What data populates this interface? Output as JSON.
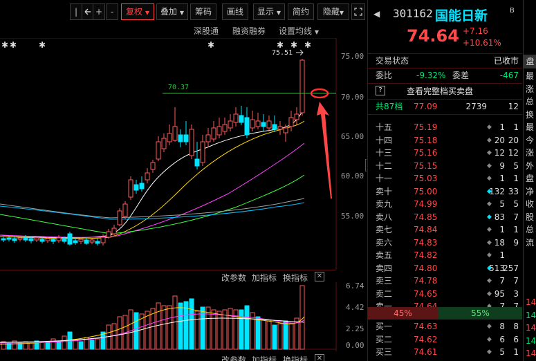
{
  "toolbar": {
    "buttons": [
      "|",
      "+",
      "-",
      "复权",
      "叠加",
      "筹码",
      "画线",
      "显示",
      "简约",
      "隐藏"
    ],
    "icons": [
      "back-arrow-icon",
      "fullscreen-icon"
    ]
  },
  "subbar": {
    "shenzhen": "深股通",
    "margin": "融资融券",
    "set_ma": "设置均线"
  },
  "price_chart": {
    "high_label": "75.51",
    "level_label": "70.37",
    "y_ticks": [
      "75.00",
      "70.00",
      "65.00",
      "60.00",
      "55.00"
    ]
  },
  "indicator_bar1": {
    "change_param": "改参数",
    "add_indicator": "加指标",
    "swap_indicator": "换指标"
  },
  "volume_chart": {
    "y_ticks": [
      "6.74",
      "4.42",
      "2.25",
      "0.00"
    ]
  },
  "indicator_bar2": {
    "change_param": "改参数",
    "add_indicator": "加指标",
    "swap_indicator": "换指标"
  },
  "quote": {
    "code": "301162",
    "name": "国能日新",
    "price": "74.64",
    "change": "+7.16",
    "change_pct": "+10.61%",
    "status_label": "交易状态",
    "status_value": "已收市",
    "wb_label": "委比",
    "wb_value": "-9.32%",
    "wc_label": "委差",
    "wc_value": "-467",
    "help_icon": "?",
    "full_book": "查看完整档买卖盘",
    "total_label": "共87档",
    "total_price": "77.09",
    "total_vol": "2739",
    "total_chg": "12",
    "ratio_sell": "45%",
    "ratio_buy": "55%",
    "colors": {
      "up": "#ff4a4a",
      "down": "#00e676",
      "accent": "#00e5ff"
    }
  },
  "asks": [
    {
      "label": "十五",
      "price": "75.19",
      "vol": "1",
      "chg": "1"
    },
    {
      "label": "十四",
      "price": "75.18",
      "vol": "20",
      "chg": "20"
    },
    {
      "label": "十三",
      "price": "75.16",
      "vol": "12",
      "chg": "12"
    },
    {
      "label": "十二",
      "price": "75.15",
      "vol": "9",
      "chg": "5"
    },
    {
      "label": "十一",
      "price": "75.03",
      "vol": "1",
      "chg": "1"
    },
    {
      "label": "卖十",
      "price": "75.00",
      "vol": "132",
      "chg": "33"
    },
    {
      "label": "卖九",
      "price": "74.99",
      "vol": "5",
      "chg": "5"
    },
    {
      "label": "卖八",
      "price": "74.85",
      "vol": "83",
      "chg": "7"
    },
    {
      "label": "卖七",
      "price": "74.84",
      "vol": "1",
      "chg": "1"
    },
    {
      "label": "卖六",
      "price": "74.83",
      "vol": "18",
      "chg": "9"
    },
    {
      "label": "卖五",
      "price": "74.82",
      "vol": "1",
      "chg": ""
    },
    {
      "label": "卖四",
      "price": "74.80",
      "vol": "513",
      "chg": "257"
    },
    {
      "label": "卖三",
      "price": "74.78",
      "vol": "7",
      "chg": "7"
    },
    {
      "label": "卖二",
      "price": "74.65",
      "vol": "95",
      "chg": "3"
    },
    {
      "label": "卖一",
      "price": "74.64",
      "vol": "7",
      "chg": "7"
    }
  ],
  "bids": [
    {
      "label": "买一",
      "price": "74.63",
      "vol": "8",
      "chg": "8"
    },
    {
      "label": "买二",
      "price": "74.62",
      "vol": "6",
      "chg": "6"
    },
    {
      "label": "买三",
      "price": "74.61",
      "vol": "5",
      "chg": "1"
    }
  ],
  "far_right": {
    "tab": "盘",
    "items": [
      "最",
      "涨",
      "总",
      "换",
      "最",
      "今",
      "涨",
      "外",
      "盘",
      "净",
      "收",
      "股",
      "总",
      "流"
    ],
    "nums": [
      "14",
      "14",
      "14",
      "14",
      "14"
    ]
  }
}
